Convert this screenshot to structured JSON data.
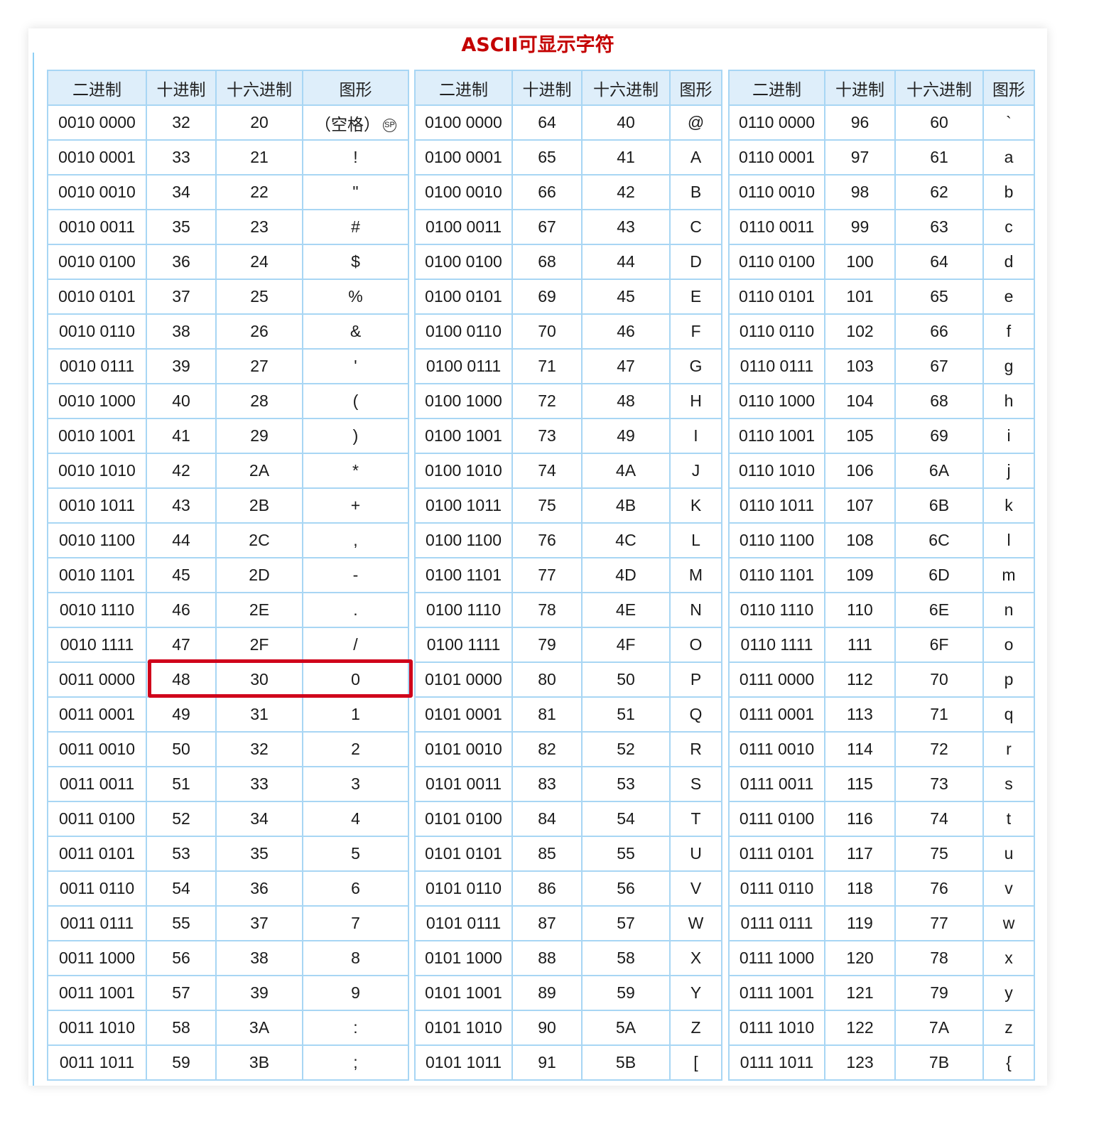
{
  "title": "ASCII可显示字符",
  "headers": [
    "二进制",
    "十进制",
    "十六进制",
    "图形"
  ],
  "space_label": "（空格）",
  "space_badge": "SP",
  "highlight": {
    "table": 0,
    "row": 16,
    "color": "#d0021b"
  },
  "colors": {
    "title": "#c40000",
    "border": "#a8d6f4",
    "header_bg": "#deeefa"
  },
  "tables": [
    {
      "rows": [
        [
          "0010 0000",
          "32",
          "20",
          "(空格)"
        ],
        [
          "0010 0001",
          "33",
          "21",
          "!"
        ],
        [
          "0010 0010",
          "34",
          "22",
          "\""
        ],
        [
          "0010 0011",
          "35",
          "23",
          "#"
        ],
        [
          "0010 0100",
          "36",
          "24",
          "$"
        ],
        [
          "0010 0101",
          "37",
          "25",
          "%"
        ],
        [
          "0010 0110",
          "38",
          "26",
          "&"
        ],
        [
          "0010 0111",
          "39",
          "27",
          "'"
        ],
        [
          "0010 1000",
          "40",
          "28",
          "("
        ],
        [
          "0010 1001",
          "41",
          "29",
          ")"
        ],
        [
          "0010 1010",
          "42",
          "2A",
          "*"
        ],
        [
          "0010 1011",
          "43",
          "2B",
          "+"
        ],
        [
          "0010 1100",
          "44",
          "2C",
          ","
        ],
        [
          "0010 1101",
          "45",
          "2D",
          "-"
        ],
        [
          "0010 1110",
          "46",
          "2E",
          "."
        ],
        [
          "0010 1111",
          "47",
          "2F",
          "/"
        ],
        [
          "0011 0000",
          "48",
          "30",
          "0"
        ],
        [
          "0011 0001",
          "49",
          "31",
          "1"
        ],
        [
          "0011 0010",
          "50",
          "32",
          "2"
        ],
        [
          "0011 0011",
          "51",
          "33",
          "3"
        ],
        [
          "0011 0100",
          "52",
          "34",
          "4"
        ],
        [
          "0011 0101",
          "53",
          "35",
          "5"
        ],
        [
          "0011 0110",
          "54",
          "36",
          "6"
        ],
        [
          "0011 0111",
          "55",
          "37",
          "7"
        ],
        [
          "0011 1000",
          "56",
          "38",
          "8"
        ],
        [
          "0011 1001",
          "57",
          "39",
          "9"
        ],
        [
          "0011 1010",
          "58",
          "3A",
          ":"
        ],
        [
          "0011 1011",
          "59",
          "3B",
          ";"
        ]
      ]
    },
    {
      "rows": [
        [
          "0100 0000",
          "64",
          "40",
          "@"
        ],
        [
          "0100 0001",
          "65",
          "41",
          "A"
        ],
        [
          "0100 0010",
          "66",
          "42",
          "B"
        ],
        [
          "0100 0011",
          "67",
          "43",
          "C"
        ],
        [
          "0100 0100",
          "68",
          "44",
          "D"
        ],
        [
          "0100 0101",
          "69",
          "45",
          "E"
        ],
        [
          "0100 0110",
          "70",
          "46",
          "F"
        ],
        [
          "0100 0111",
          "71",
          "47",
          "G"
        ],
        [
          "0100 1000",
          "72",
          "48",
          "H"
        ],
        [
          "0100 1001",
          "73",
          "49",
          "I"
        ],
        [
          "0100 1010",
          "74",
          "4A",
          "J"
        ],
        [
          "0100 1011",
          "75",
          "4B",
          "K"
        ],
        [
          "0100 1100",
          "76",
          "4C",
          "L"
        ],
        [
          "0100 1101",
          "77",
          "4D",
          "M"
        ],
        [
          "0100 1110",
          "78",
          "4E",
          "N"
        ],
        [
          "0100 1111",
          "79",
          "4F",
          "O"
        ],
        [
          "0101 0000",
          "80",
          "50",
          "P"
        ],
        [
          "0101 0001",
          "81",
          "51",
          "Q"
        ],
        [
          "0101 0010",
          "82",
          "52",
          "R"
        ],
        [
          "0101 0011",
          "83",
          "53",
          "S"
        ],
        [
          "0101 0100",
          "84",
          "54",
          "T"
        ],
        [
          "0101 0101",
          "85",
          "55",
          "U"
        ],
        [
          "0101 0110",
          "86",
          "56",
          "V"
        ],
        [
          "0101 0111",
          "87",
          "57",
          "W"
        ],
        [
          "0101 1000",
          "88",
          "58",
          "X"
        ],
        [
          "0101 1001",
          "89",
          "59",
          "Y"
        ],
        [
          "0101 1010",
          "90",
          "5A",
          "Z"
        ],
        [
          "0101 1011",
          "91",
          "5B",
          "["
        ]
      ]
    },
    {
      "rows": [
        [
          "0110 0000",
          "96",
          "60",
          "`"
        ],
        [
          "0110 0001",
          "97",
          "61",
          "a"
        ],
        [
          "0110 0010",
          "98",
          "62",
          "b"
        ],
        [
          "0110 0011",
          "99",
          "63",
          "c"
        ],
        [
          "0110 0100",
          "100",
          "64",
          "d"
        ],
        [
          "0110 0101",
          "101",
          "65",
          "e"
        ],
        [
          "0110 0110",
          "102",
          "66",
          "f"
        ],
        [
          "0110 0111",
          "103",
          "67",
          "g"
        ],
        [
          "0110 1000",
          "104",
          "68",
          "h"
        ],
        [
          "0110 1001",
          "105",
          "69",
          "i"
        ],
        [
          "0110 1010",
          "106",
          "6A",
          "j"
        ],
        [
          "0110 1011",
          "107",
          "6B",
          "k"
        ],
        [
          "0110 1100",
          "108",
          "6C",
          "l"
        ],
        [
          "0110 1101",
          "109",
          "6D",
          "m"
        ],
        [
          "0110 1110",
          "110",
          "6E",
          "n"
        ],
        [
          "0110 1111",
          "111",
          "6F",
          "o"
        ],
        [
          "0111 0000",
          "112",
          "70",
          "p"
        ],
        [
          "0111 0001",
          "113",
          "71",
          "q"
        ],
        [
          "0111 0010",
          "114",
          "72",
          "r"
        ],
        [
          "0111 0011",
          "115",
          "73",
          "s"
        ],
        [
          "0111 0100",
          "116",
          "74",
          "t"
        ],
        [
          "0111 0101",
          "117",
          "75",
          "u"
        ],
        [
          "0111 0110",
          "118",
          "76",
          "v"
        ],
        [
          "0111 0111",
          "119",
          "77",
          "w"
        ],
        [
          "0111 1000",
          "120",
          "78",
          "x"
        ],
        [
          "0111 1001",
          "121",
          "79",
          "y"
        ],
        [
          "0111 1010",
          "122",
          "7A",
          "z"
        ],
        [
          "0111 1011",
          "123",
          "7B",
          "{"
        ]
      ]
    }
  ]
}
